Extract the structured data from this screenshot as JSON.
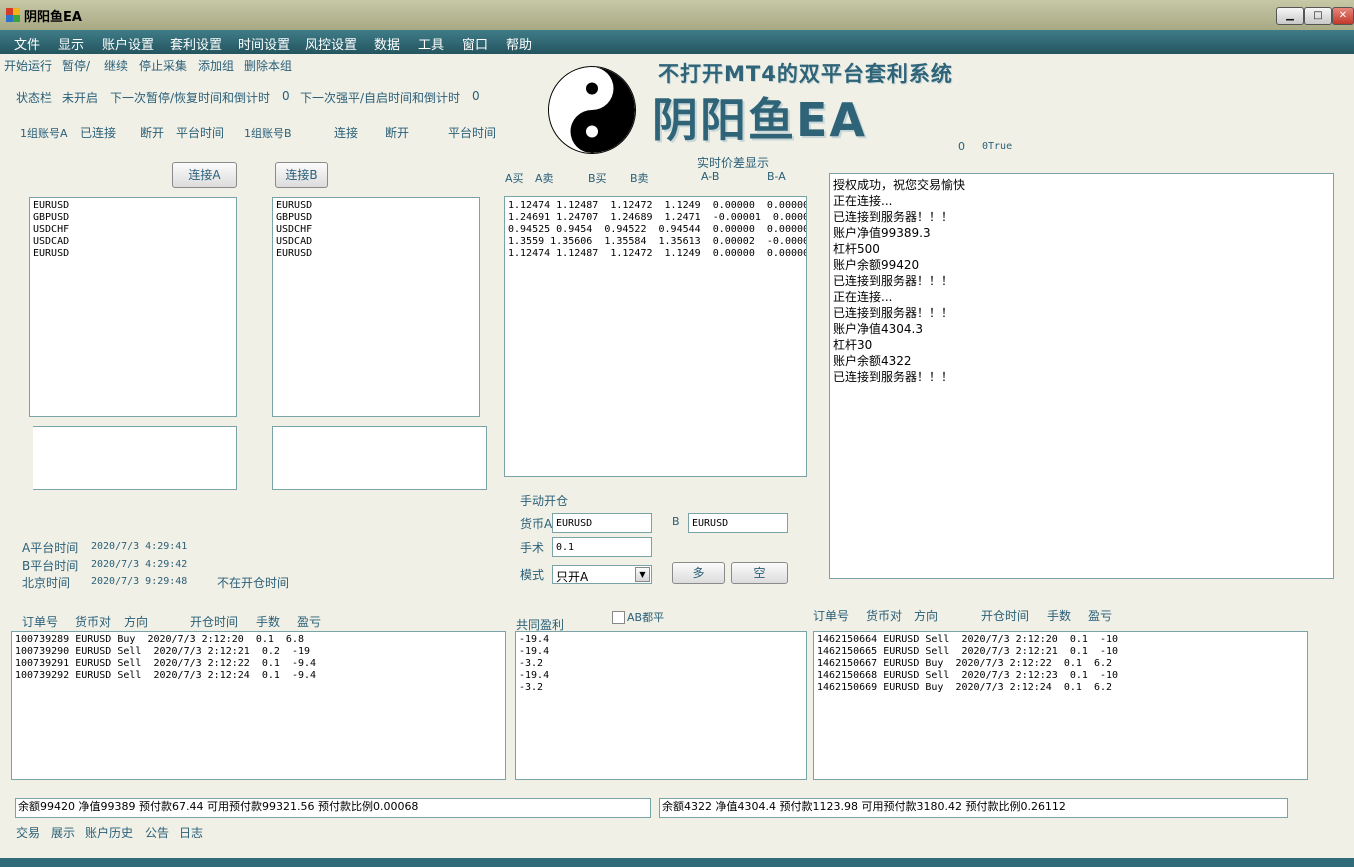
{
  "window": {
    "title": "阴阳鱼EA",
    "controls": {
      "minimize": "▁",
      "maximize": "□",
      "close": "✕"
    }
  },
  "menu": [
    "文件",
    "显示",
    "账户设置",
    "套利设置",
    "时间设置",
    "风控设置",
    "数据",
    "工具",
    "窗口",
    "帮助"
  ],
  "toolbar": [
    "开始运行",
    "暂停/",
    "继续",
    "停止采集",
    "添加组",
    "删除本组"
  ],
  "status": {
    "label": "状态栏",
    "state": "未开启",
    "pause_label": "下一次暂停/恢复时间和倒计时",
    "pause_value": "0",
    "close_label": "下一次强平/自启时间和倒计时",
    "close_value": "0"
  },
  "group_row": {
    "a_label": "1组账号A",
    "a_connected": "已连接",
    "a_disconnect": "断开",
    "a_time": "平台时间",
    "b_label": "1组账号B",
    "b_connect": "连接",
    "b_disconnect": "断开",
    "b_time": "平台时间"
  },
  "flags": {
    "zero": "0",
    "true_text": "0True"
  },
  "logo": {
    "slogan": "不打开MT4的双平台套利系统",
    "name": "阴阳鱼EA"
  },
  "connect_a_label": "连接A",
  "connect_b_label": "连接B",
  "symbols_a": [
    "EURUSD",
    "GBPUSD",
    "USDCHF",
    "USDCAD",
    "EURUSD"
  ],
  "symbols_b": [
    "EURUSD",
    "GBPUSD",
    "USDCHF",
    "USDCAD",
    "EURUSD"
  ],
  "spread": {
    "title": "实时价差显示",
    "headers": [
      "A买",
      "A卖",
      "B买",
      "B卖",
      "A-B",
      "B-A"
    ],
    "rows": [
      "1.12474 1.12487  1.12472  1.1249  0.00000  0.00000",
      "1.24691 1.24707  1.24689  1.2471  -0.00001  0.0000",
      "0.94525 0.9454  0.94522  0.94544  0.00000  0.00000",
      "1.3559 1.35606  1.35584  1.35613  0.00002  -0.0000",
      "1.12474 1.12487  1.12472  1.1249  0.00000  0.00000"
    ]
  },
  "log": [
    "授权成功，祝您交易愉快",
    "正在连接...",
    "已连接到服务器！！！",
    "账户净值99389.3",
    "杠杆500",
    "账户余额99420",
    "已连接到服务器！！！",
    "正在连接...",
    "已连接到服务器！！！",
    "账户净值4304.3",
    "杠杆30",
    "账户余额4322",
    "已连接到服务器！！！"
  ],
  "manual": {
    "title": "手动开仓",
    "currency_a_label": "货币A",
    "currency_a": "EURUSD",
    "b_label": "B",
    "currency_b": "EURUSD",
    "lots_label": "手术",
    "lots": "0.1",
    "mode_label": "模式",
    "mode": "只开A",
    "long_label": "多",
    "short_label": "空"
  },
  "times": {
    "a_label": "A平台时间",
    "a_value": "2020/7/3 4:29:41",
    "b_label": "B平台时间",
    "b_value": "2020/7/3 4:29:42",
    "bj_label": "北京时间",
    "bj_value": "2020/7/3 9:29:48",
    "note": "不在开仓时间"
  },
  "orders_headers": [
    "订单号",
    "货币对",
    "方向",
    "开仓时间",
    "手数",
    "盈亏"
  ],
  "orders_a": [
    "100739289 EURUSD Buy  2020/7/3 2:12:20  0.1  6.8",
    "100739290 EURUSD Sell  2020/7/3 2:12:21  0.2  -19",
    "100739291 EURUSD Sell  2020/7/3 2:12:22  0.1  -9.4",
    "100739292 EURUSD Sell  2020/7/3 2:12:24  0.1  -9.4"
  ],
  "common": {
    "title": "共同盈利",
    "ab_label": "AB都平",
    "values": [
      "-19.4",
      "-19.4",
      "-3.2",
      "-19.4",
      "-3.2"
    ]
  },
  "orders_b": [
    "1462150664 EURUSD Sell  2020/7/3 2:12:20  0.1  -10",
    "1462150665 EURUSD Sell  2020/7/3 2:12:21  0.1  -10",
    "1462150667 EURUSD Buy  2020/7/3 2:12:22  0.1  6.2",
    "1462150668 EURUSD Sell  2020/7/3 2:12:23  0.1  -10",
    "1462150669 EURUSD Buy  2020/7/3 2:12:24  0.1  6.2"
  ],
  "account_a": "余额99420  净值99389  预付款67.44  可用预付款99321.56  预付款比例0.00068",
  "account_b": "余额4322  净值4304.4  预付款1123.98  可用预付款3180.42  预付款比例0.26112",
  "bottom_tabs": [
    "交易",
    "展示",
    "账户历史",
    "公告",
    "日志"
  ]
}
